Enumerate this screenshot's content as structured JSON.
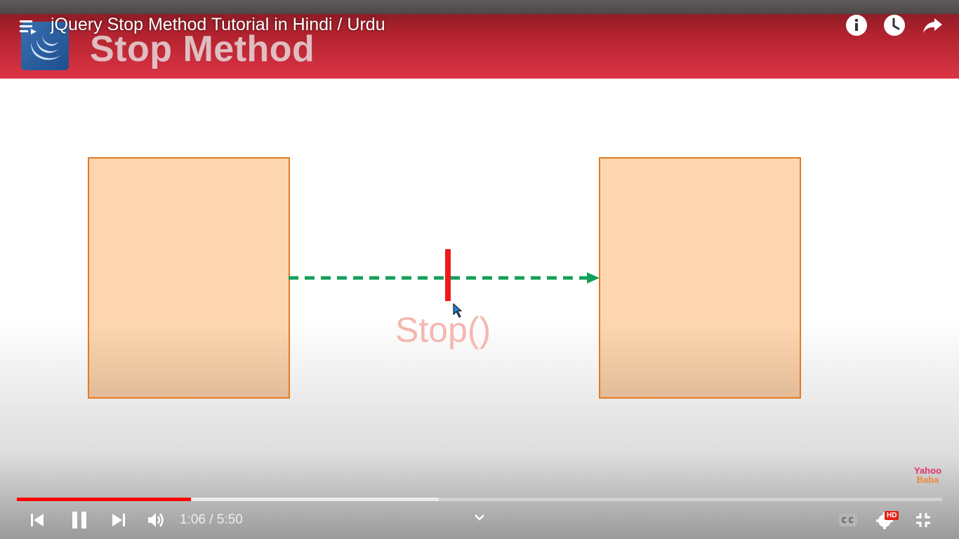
{
  "video": {
    "title": "jQuery Stop Method Tutorial in Hindi / Urdu",
    "current_time": "1:06",
    "time_separator": " / ",
    "duration": "5:50",
    "progress_played": 0.188,
    "progress_buffered": 0.456
  },
  "slide": {
    "title": "Stop Method",
    "stop_label": "Stop()",
    "watermark_line1": "Yahoo",
    "watermark_line2": "Baba"
  },
  "controls": {
    "hd_badge": "HD"
  },
  "colors": {
    "header_red": "#dc3446",
    "box_fill": "#fdd6b0",
    "box_border": "#e37a1e",
    "arrow_green": "#12a05a",
    "stop_bar_red": "#ee1a1a",
    "progress_red": "#ff0000"
  },
  "icons": [
    "playlist-icon",
    "info-icon",
    "watch-later-icon",
    "share-icon",
    "previous-icon",
    "pause-icon",
    "next-icon",
    "volume-icon",
    "chevron-down-icon",
    "captions-icon",
    "settings-icon",
    "exit-fullscreen-icon",
    "mouse-cursor-icon",
    "jquery-logo"
  ]
}
